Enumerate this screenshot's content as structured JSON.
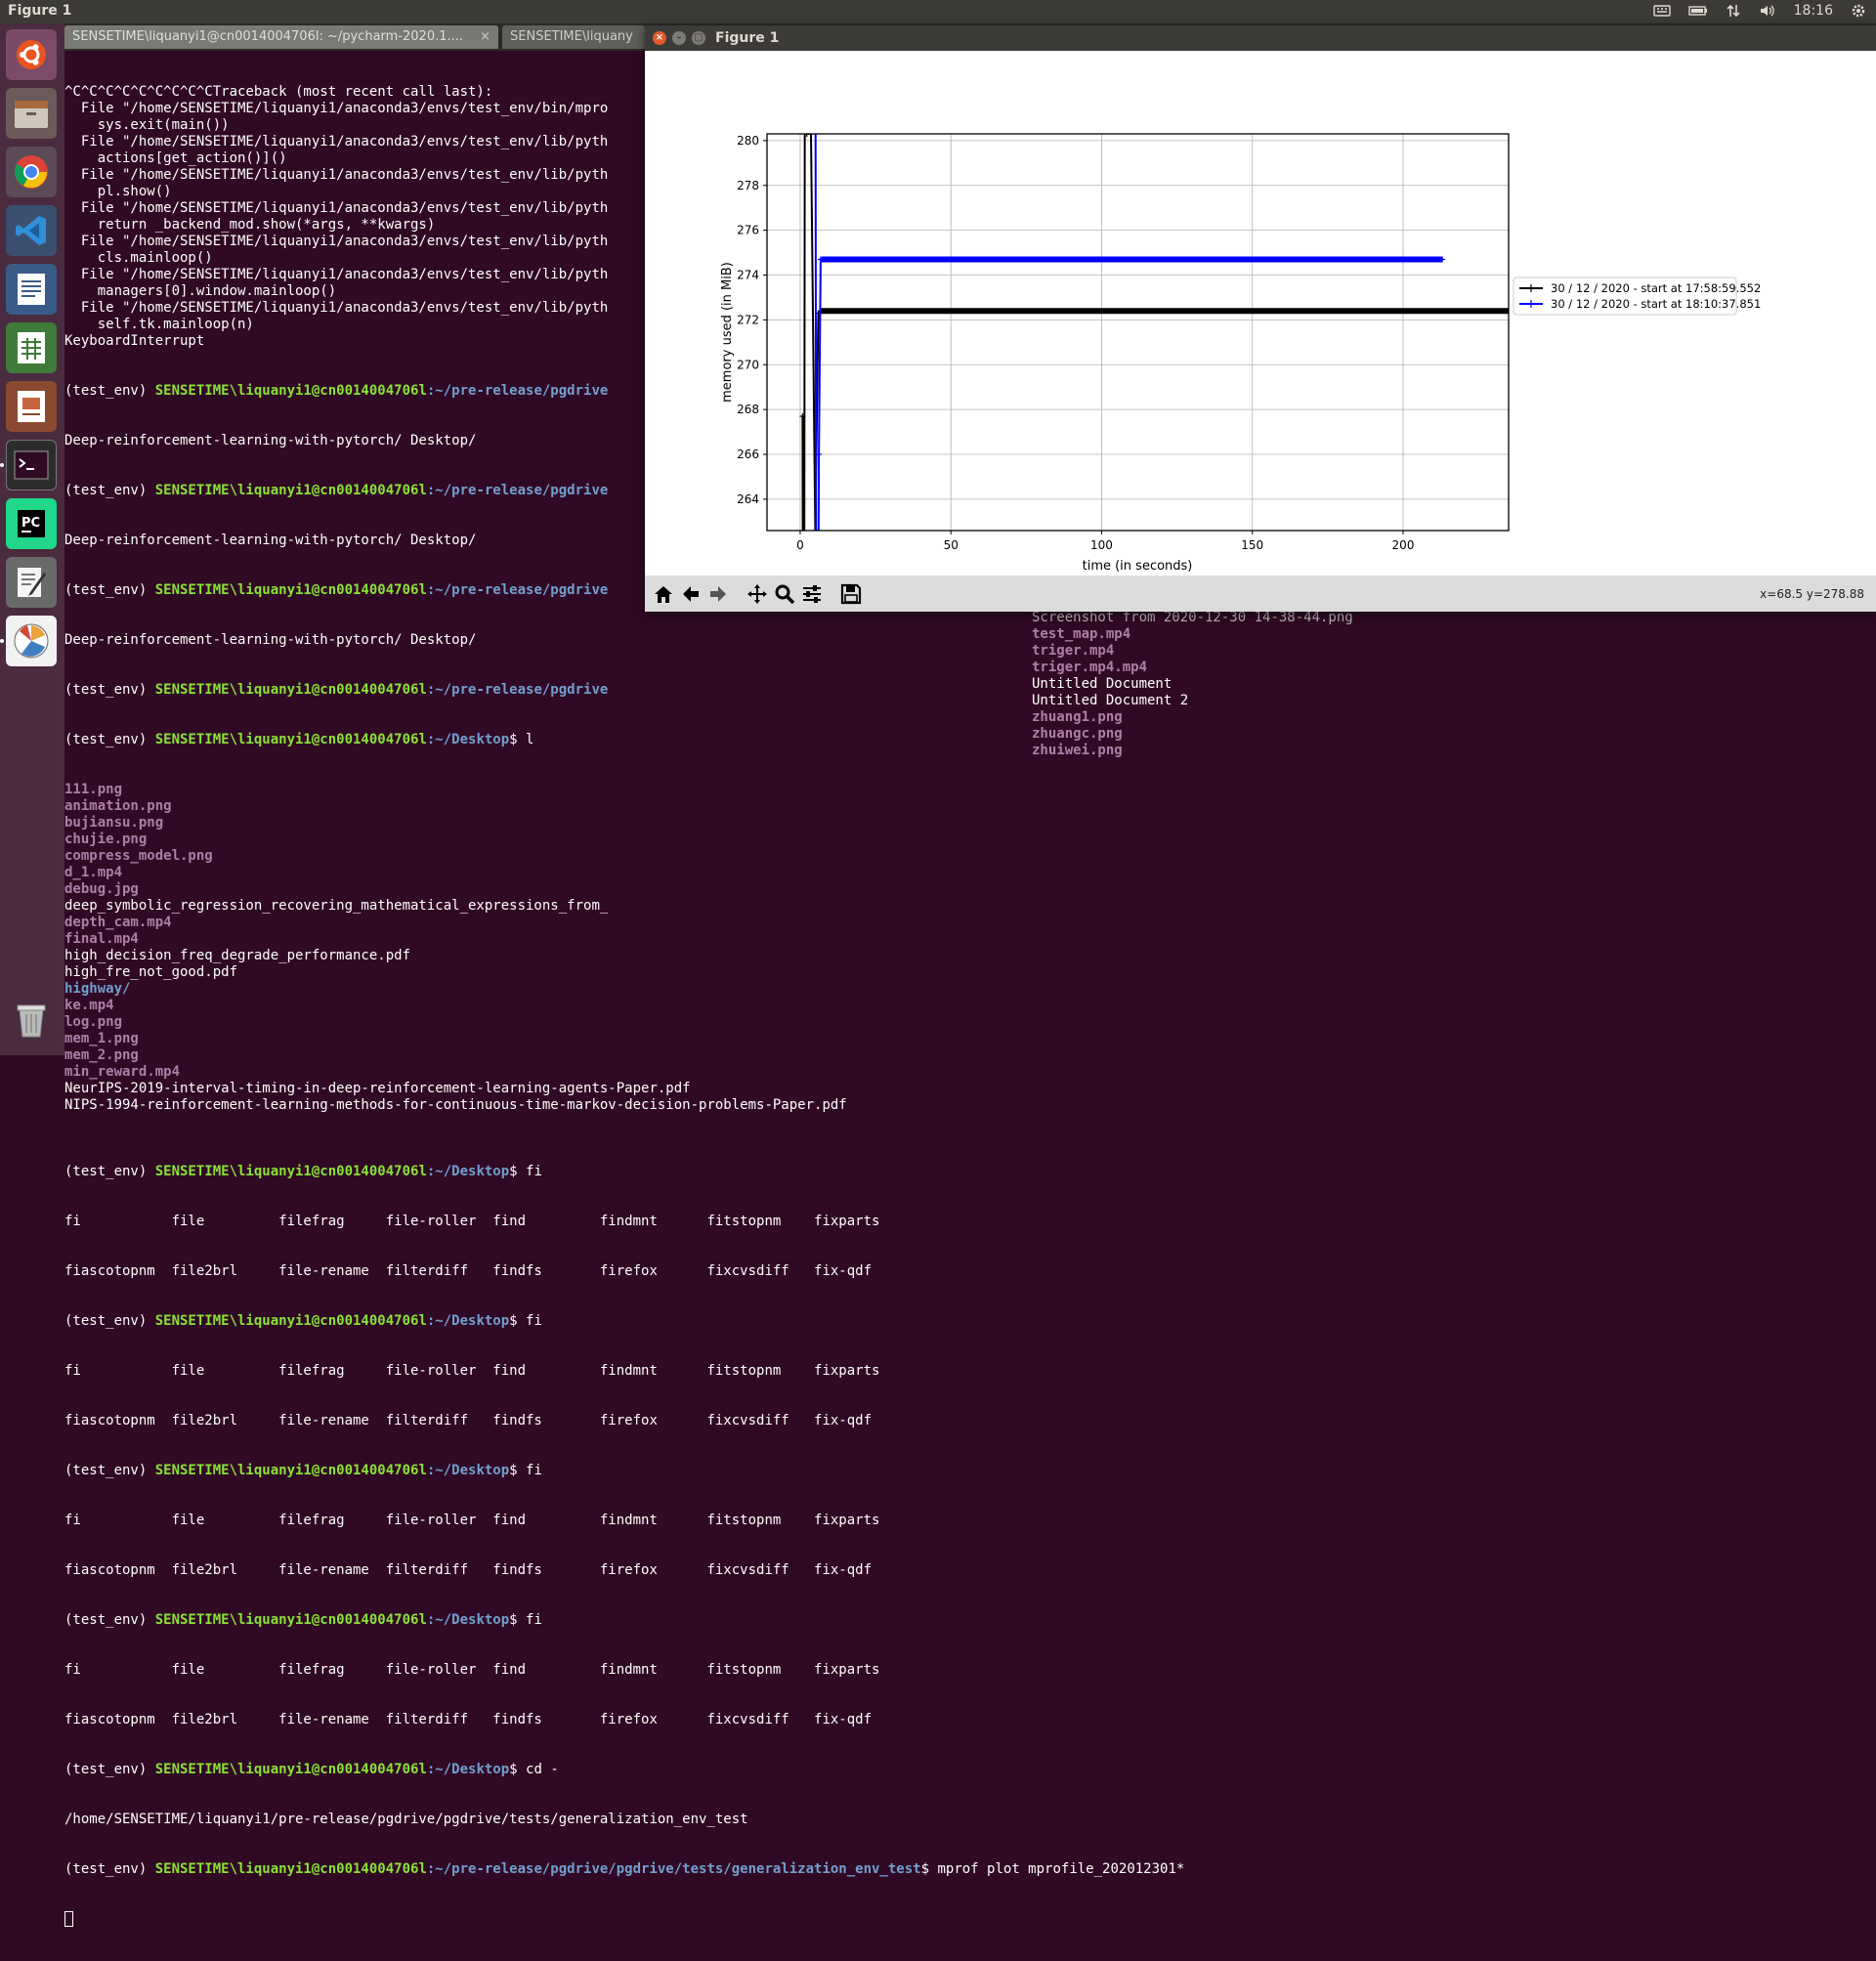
{
  "topbar": {
    "title": "Figure 1",
    "clock": "18:16",
    "indicator_icons": [
      "keyboard-icon",
      "battery-icon",
      "network-icon",
      "volume-icon",
      "gear-icon"
    ]
  },
  "launcher": {
    "apps": [
      "ubuntu-dash-icon",
      "files-icon",
      "chrome-icon",
      "vscode-icon",
      "writer-icon",
      "calc-icon",
      "impress-icon",
      "terminal-icon",
      "pycharm-icon",
      "text-editor-icon",
      "python-plot-icon",
      "trash-icon"
    ]
  },
  "terminal": {
    "tabs": [
      {
        "label": "SENSETIME\\liquanyi1@cn0014004706l: ~/pycharm-2020.1....",
        "close": "×"
      },
      {
        "label": "SENSETIME\\liquany"
      }
    ],
    "prompt_env": "(test_env) ",
    "prompt_user": "SENSETIME\\liquanyi1@cn0014004706l",
    "traceback": [
      "^C^C^C^C^C^C^C^C^CTraceback (most recent call last):",
      "  File \"/home/SENSETIME/liquanyi1/anaconda3/envs/test_env/bin/mpro",
      "    sys.exit(main())",
      "  File \"/home/SENSETIME/liquanyi1/anaconda3/envs/test_env/lib/pyth",
      "    actions[get_action()]()",
      "  File \"/home/SENSETIME/liquanyi1/anaconda3/envs/test_env/lib/pyth",
      "    pl.show()",
      "  File \"/home/SENSETIME/liquanyi1/anaconda3/envs/test_env/lib/pyth",
      "    return _backend_mod.show(*args, **kwargs)",
      "  File \"/home/SENSETIME/liquanyi1/anaconda3/envs/test_env/lib/pyth",
      "    cls.mainloop()",
      "  File \"/home/SENSETIME/liquanyi1/anaconda3/envs/test_env/lib/pyth",
      "    managers[0].window.mainloop()",
      "  File \"/home/SENSETIME/liquanyi1/anaconda3/envs/test_env/lib/pyth",
      "    self.tk.mainloop(n)",
      "KeyboardInterrupt"
    ],
    "path_pgdrive": ":~/pre-release/pgdrive",
    "desktop_line": "Deep-reinforcement-learning-with-pytorch/ Desktop/",
    "path_desktop": ":~/Desktop",
    "cmd_l": "$ l",
    "files": [
      {
        "name": "111.png",
        "type": "media"
      },
      {
        "name": "animation.png",
        "type": "media"
      },
      {
        "name": "bujiansu.png",
        "type": "media"
      },
      {
        "name": "chujie.png",
        "type": "media"
      },
      {
        "name": "compress_model.png",
        "type": "media"
      },
      {
        "name": "d_1.mp4",
        "type": "media"
      },
      {
        "name": "debug.jpg",
        "type": "media"
      },
      {
        "name": "deep_symbolic_regression_recovering_mathematical_expressions_from_",
        "type": "file"
      },
      {
        "name": "depth_cam.mp4",
        "type": "media"
      },
      {
        "name": "final.mp4",
        "type": "media"
      },
      {
        "name": "high_decision_freq_degrade_performance.pdf",
        "type": "file"
      },
      {
        "name": "high_fre_not_good.pdf",
        "type": "file"
      },
      {
        "name": "highway/",
        "type": "dir"
      },
      {
        "name": "ke.mp4",
        "type": "media"
      },
      {
        "name": "log.png",
        "type": "media"
      },
      {
        "name": "mem_1.png",
        "type": "media"
      },
      {
        "name": "mem_2.png",
        "type": "media"
      },
      {
        "name": "min_reward.mp4",
        "type": "media"
      },
      {
        "name": "NeurIPS-2019-interval-timing-in-deep-reinforcement-learning-agents-Paper.pdf",
        "type": "file"
      },
      {
        "name": "NIPS-1994-reinforcement-learning-methods-for-continuous-time-markov-decision-problems-Paper.pdf",
        "type": "file"
      }
    ],
    "right_files": [
      {
        "name": "Screenshot from 2020-12-30 14-38-44.png",
        "type": "gray"
      },
      {
        "name": "test_map.mp4",
        "type": "media"
      },
      {
        "name": "triger.mp4",
        "type": "media"
      },
      {
        "name": "triger.mp4.mp4",
        "type": "media"
      },
      {
        "name": "Untitled Document",
        "type": "file"
      },
      {
        "name": "Untitled Document 2",
        "type": "file"
      },
      {
        "name": "zhuang1.png",
        "type": "media"
      },
      {
        "name": "zhuangc.png",
        "type": "media"
      },
      {
        "name": "zhuiwei.png",
        "type": "media"
      }
    ],
    "cmd_fi": "$ fi",
    "completion_row1": "fi           file         filefrag     file-roller  find         findmnt      fitstopnm    fixparts",
    "completion_row2": "fiascotopnm  file2brl     file-rename  filterdiff   findfs       firefox      fixcvsdiff   fix-qdf",
    "cmd_cd": "$ cd -",
    "cd_output": "/home/SENSETIME/liquanyi1/pre-release/pgdrive/pgdrive/tests/generalization_env_test",
    "path_final": ":~/pre-release/pgdrive/pgdrive/tests/generalization_env_test",
    "cmd_final": "$ mprof plot mprofile_202012301*"
  },
  "figure": {
    "window_title": "Figure 1",
    "close_glyph": "×",
    "coords": "x=68.5 y=278.88",
    "toolbar_icons": [
      "home-icon",
      "back-icon",
      "forward-icon",
      "pan-icon",
      "zoom-icon",
      "configure-subplots-icon",
      "save-icon"
    ]
  },
  "chart_data": {
    "type": "line",
    "xlabel": "time (in seconds)",
    "ylabel": "memory used (in MiB)",
    "xlim": [
      -11,
      235
    ],
    "ylim": [
      262.6,
      280.3
    ],
    "xticks": [
      0,
      50,
      100,
      150,
      200
    ],
    "yticks": [
      264,
      266,
      268,
      270,
      272,
      274,
      276,
      278,
      280
    ],
    "grid": true,
    "legend_position": "right",
    "series": [
      {
        "name": "30 / 12 / 2020 - start at 17:58:59.552",
        "color": "#000000",
        "x": [
          0.8,
          1.2,
          1.6,
          2.2,
          3.6,
          5,
          6,
          7,
          235
        ],
        "y": [
          267.7,
          240,
          290,
          280.3,
          280.3,
          262.6,
          272.3,
          272.4,
          272.4
        ]
      },
      {
        "name": "30 / 12 / 2020 - start at 18:10:37.851",
        "color": "#0000ff",
        "x": [
          5,
          5.5,
          6.2,
          6.8,
          7.3,
          213
        ],
        "y": [
          290,
          240,
          266.0,
          274.7,
          274.7,
          274.7
        ]
      }
    ]
  }
}
